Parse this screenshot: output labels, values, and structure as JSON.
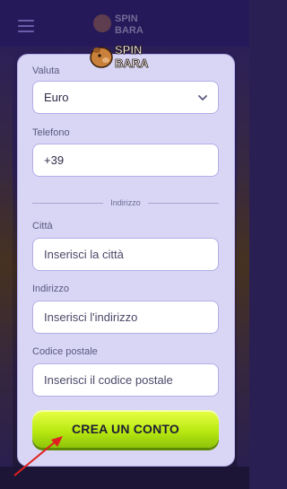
{
  "brand": {
    "logo_line1": "SPIN",
    "logo_line2": "BARA"
  },
  "form": {
    "currency": {
      "label": "Valuta",
      "value": "Euro"
    },
    "phone": {
      "label": "Telefono",
      "value": "+39"
    },
    "section_address": "Indirizzo",
    "city": {
      "label": "Città",
      "placeholder": "Inserisci la città"
    },
    "address": {
      "label": "Indirizzo",
      "placeholder": "Inserisci l'indirizzo"
    },
    "postal_code": {
      "label": "Codice postale",
      "placeholder": "Inserisci il codice postale"
    },
    "submit_label": "CREA UN CONTO"
  },
  "colors": {
    "modal_bg": "#d8d6f4",
    "input_border": "#b3aee8",
    "cta_top": "#e9ff46",
    "cta_bottom": "#8ec409",
    "arrow": "#e02020"
  }
}
